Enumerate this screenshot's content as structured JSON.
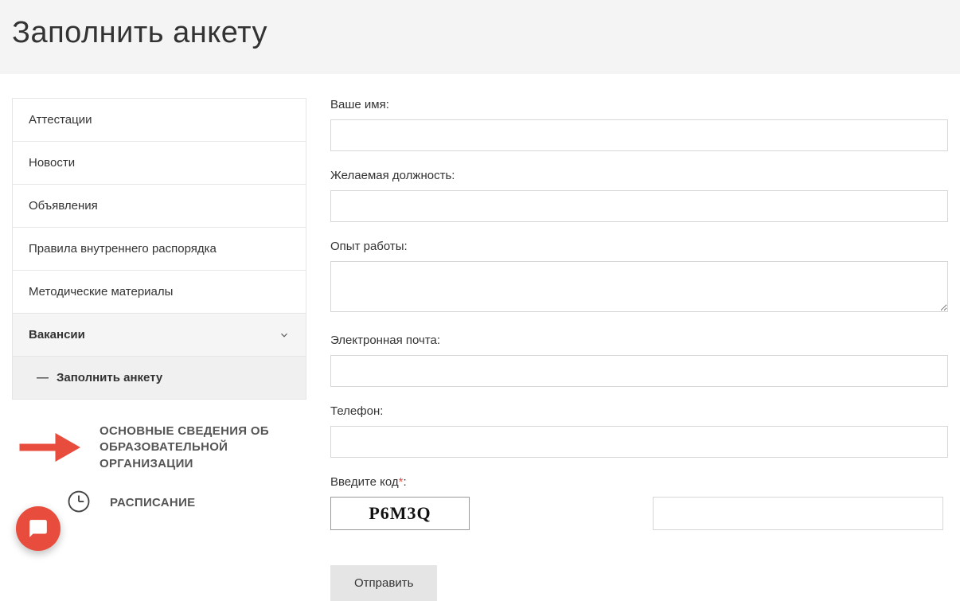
{
  "header": {
    "title": "Заполнить анкету"
  },
  "sidebar": {
    "items": [
      {
        "label": "Аттестации"
      },
      {
        "label": "Новости"
      },
      {
        "label": "Объявления"
      },
      {
        "label": "Правила внутреннего распорядка"
      },
      {
        "label": "Методические материалы"
      },
      {
        "label": "Вакансии"
      },
      {
        "label": "Заполнить анкету"
      }
    ],
    "promo1": "ОСНОВНЫЕ СВЕДЕНИЯ ОБ ОБРАЗОВАТЕЛЬНОЙ ОРГАНИЗАЦИИ",
    "promo2": "РАСПИСАНИЕ"
  },
  "form": {
    "name_label": "Ваше имя:",
    "position_label": "Желаемая должность:",
    "experience_label": "Опыт работы:",
    "email_label": "Электронная почта:",
    "phone_label": "Телефон:",
    "captcha_label": "Введите код",
    "captcha_value": "P6M3Q",
    "submit_label": "Отправить"
  }
}
